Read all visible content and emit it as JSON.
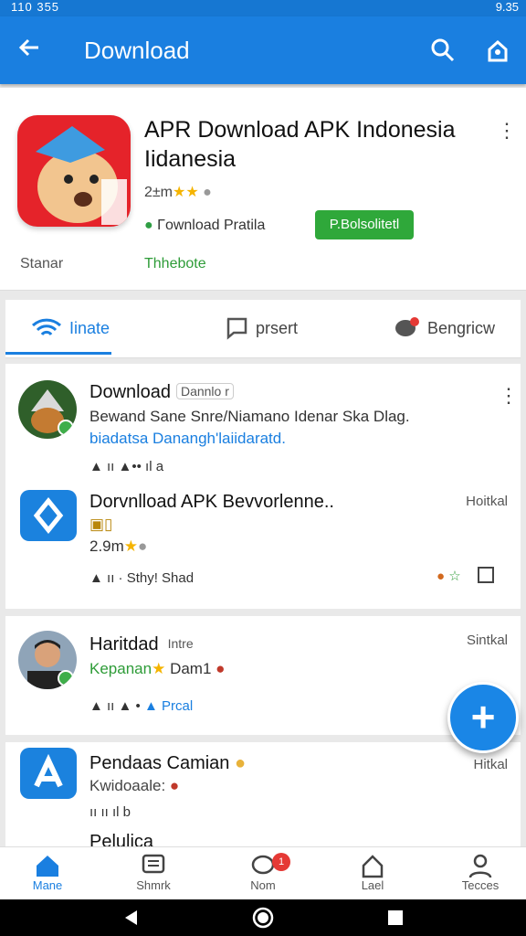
{
  "status_bar": {
    "left": "110 355",
    "right": "9.35"
  },
  "app_bar": {
    "title": "Download"
  },
  "app_header": {
    "title": "APR Download APK Indonesia Iidanesia",
    "rating": "2±m",
    "publisher": "Γownload Pratila",
    "action_label": "P.Bolsolitetl",
    "left_label": "Stanar",
    "green_label": "Thhebote"
  },
  "tabs": [
    {
      "label": "Iinate"
    },
    {
      "label": "prsert"
    },
    {
      "label": "Bengricw"
    }
  ],
  "posts": [
    {
      "name": "Download",
      "chip": "Dannlo r",
      "line1": "Bewand Sane Snre/Niamano Idenar Ska Dlag.",
      "line2": "biadatsa Danangh'laiidaratd.",
      "actions": "▲ ıı ▲•• ıl a"
    },
    {
      "name": "Dorvnlload APK Bevvorlenne..",
      "badge_line": "▣▯",
      "rating": "2.9m",
      "actions_link": "ıı · Sthy! Shad",
      "side": "Hoitkal"
    },
    {
      "name": "Haritdad",
      "chip": "Intre",
      "sub": "Kepanan",
      "sub2": "Dam1",
      "actions_link": "Prcal",
      "side": "Sintkal"
    },
    {
      "name": "Pendaas Camian",
      "sub": "Kwidoaale:",
      "actions": "ıı ıı ıl b",
      "side": "Hitkal"
    },
    {
      "name": "Pelulica"
    }
  ],
  "bottom_nav": [
    {
      "label": "Mane"
    },
    {
      "label": "Shmrk"
    },
    {
      "label": "Nom",
      "badge": "1"
    },
    {
      "label": "Lael"
    },
    {
      "label": "Tecces"
    }
  ],
  "colors": {
    "primary": "#1a7fe0",
    "green": "#2fa83a",
    "red": "#e5232a"
  }
}
